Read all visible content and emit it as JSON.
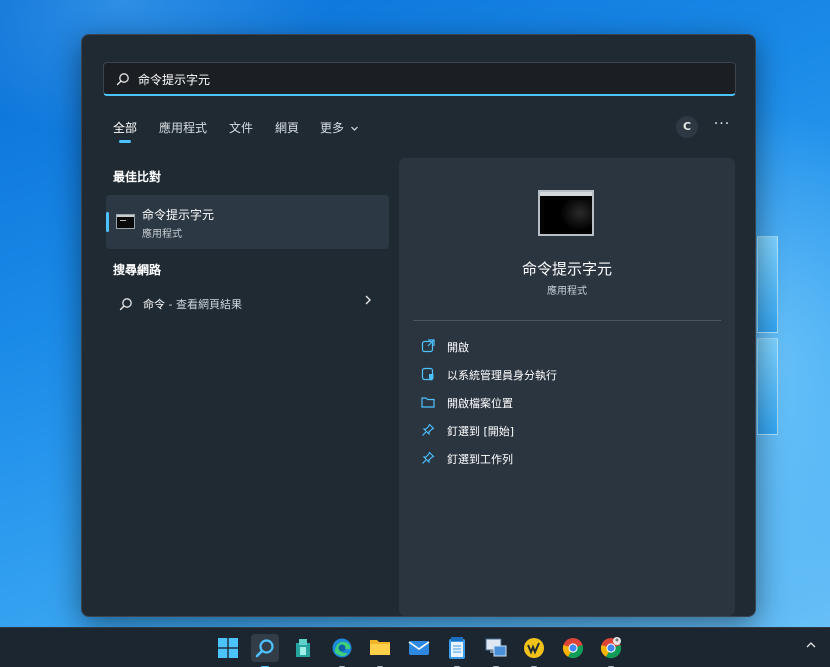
{
  "search": {
    "query": "命令提示字元"
  },
  "tabs": [
    {
      "label": "全部",
      "active": true
    },
    {
      "label": "應用程式",
      "active": false
    },
    {
      "label": "文件",
      "active": false
    },
    {
      "label": "網頁",
      "active": false
    },
    {
      "label": "更多",
      "active": false,
      "has_dropdown": true
    }
  ],
  "header_buttons": {
    "account_initial": "C",
    "more_label": "···"
  },
  "best_match": {
    "section_title": "最佳比對",
    "app_name": "命令提示字元",
    "app_type": "應用程式",
    "icon": "command-prompt-icon"
  },
  "web_search": {
    "section_title": "搜尋網路",
    "term": "命令",
    "suffix": " - 查看網頁結果"
  },
  "detail": {
    "app_name": "命令提示字元",
    "app_type": "應用程式",
    "actions": [
      {
        "label": "開啟",
        "icon": "open-external-icon"
      },
      {
        "label": "以系統管理員身分執行",
        "icon": "run-as-admin-icon"
      },
      {
        "label": "開啟檔案位置",
        "icon": "folder-icon"
      },
      {
        "label": "釘選到 [開始]",
        "icon": "pin-icon"
      },
      {
        "label": "釘選到工作列",
        "icon": "pin-icon"
      }
    ]
  },
  "taskbar": {
    "items": [
      {
        "name": "start-icon"
      },
      {
        "name": "search-icon",
        "active": true
      },
      {
        "name": "app-installer-icon"
      },
      {
        "name": "edge-icon"
      },
      {
        "name": "file-explorer-icon"
      },
      {
        "name": "mail-icon"
      },
      {
        "name": "notepad-icon"
      },
      {
        "name": "remote-desktop-icon"
      },
      {
        "name": "app-icon"
      },
      {
        "name": "chrome-icon"
      },
      {
        "name": "chrome-profile-icon"
      }
    ],
    "tray_chevron": "^"
  },
  "colors": {
    "accent": "#4cc2ff",
    "flyout_bg": "#1f2a33",
    "detail_bg": "#2a3540"
  }
}
